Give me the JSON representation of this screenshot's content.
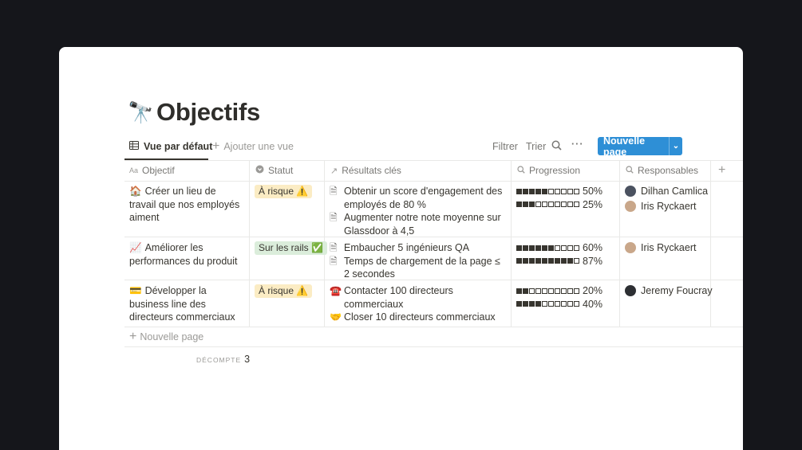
{
  "page": {
    "icon": "🔭",
    "title": "Objectifs"
  },
  "viewbar": {
    "tab_label": "Vue par défaut",
    "tab_icon": "table-icon",
    "add_view_label": "Ajouter une vue",
    "filter_label": "Filtrer",
    "sort_label": "Trier",
    "new_page_label": "Nouvelle page"
  },
  "columns": {
    "objective": "Objectif",
    "status": "Statut",
    "key_results": "Résultats clés",
    "progress": "Progression",
    "owners": "Responsables"
  },
  "rows": [
    {
      "emoji": "🏠",
      "objective": "Créer un lieu de travail que nos employés aiment",
      "status": "À risque ⚠️",
      "status_color": "#fbecc4",
      "key_results": [
        "Obtenir un score d'engagement des employés de 80 %",
        "Augmenter notre note moyenne sur Glassdoor à 4,5"
      ],
      "progress": [
        {
          "filled": 5,
          "pct": "50%"
        },
        {
          "filled": 3,
          "pct": "25%"
        }
      ],
      "owners": [
        {
          "name": "Dilhan Camlica",
          "avatar": "#4b5260"
        },
        {
          "name": "Iris Ryckaert",
          "avatar": "#c9a78a"
        }
      ]
    },
    {
      "emoji": "📈",
      "objective": "Améliorer les performances du produit",
      "status": "Sur les rails ✅",
      "status_color": "#dbeddb",
      "key_results": [
        "Embaucher 5 ingénieurs QA",
        "Temps de chargement de la page ≤ 2 secondes"
      ],
      "progress": [
        {
          "filled": 6,
          "pct": "60%"
        },
        {
          "filled": 9,
          "pct": "87%"
        }
      ],
      "owners": [
        {
          "name": "Iris Ryckaert",
          "avatar": "#c9a78a"
        }
      ]
    },
    {
      "emoji": "💳",
      "objective": "Développer la business line des directeurs commerciaux",
      "status": "À risque ⚠️",
      "status_color": "#fbecc4",
      "key_results": [
        "Contacter 100 directeurs commerciaux",
        "Closer 10 directeurs commerciaux"
      ],
      "key_result_icons": [
        "☎️",
        "🤝"
      ],
      "progress": [
        {
          "filled": 2,
          "pct": "20%"
        },
        {
          "filled": 4,
          "pct": "40%"
        }
      ],
      "owners": [
        {
          "name": "Jeremy Foucray",
          "avatar": "#2d2f33"
        }
      ]
    }
  ],
  "footer": {
    "new_page_label": "Nouvelle page",
    "count_label": "DÉCOMPTE",
    "count_value": "3"
  }
}
